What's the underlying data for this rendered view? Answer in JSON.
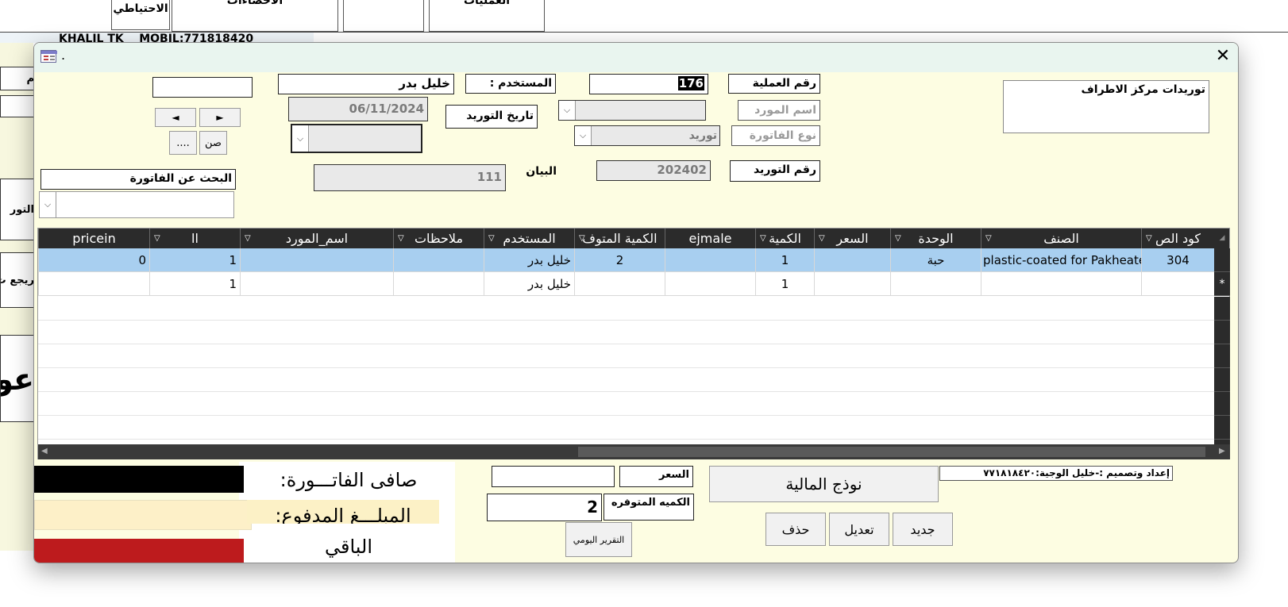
{
  "background": {
    "tabs": [
      {
        "label": "الاحتياطي"
      },
      {
        "label": "الاحصاءات"
      },
      {
        "label": ""
      },
      {
        "label": "العمليات"
      }
    ],
    "header_text": "KHALIL TK    MOBIL:771818420",
    "left_cut": [
      "م",
      "التور",
      "ريجع ت",
      "عو"
    ]
  },
  "dialog": {
    "title": ".",
    "panel_title": "توريدات مركز الاطراف",
    "op_number_label": "رقم العملية",
    "op_number_value": "176",
    "user_label": "المستخدم :",
    "user_value": "خليل بدر",
    "supplier_name_placeholder": "اسم المورد",
    "supply_date_label": "تاريخ التوريد",
    "supply_date_value": "06/11/2024",
    "invoice_type_placeholder": "نوع الفاتورة",
    "invoice_type_value": "توريد",
    "supply_number_label": "رقم التوريد",
    "supply_number_value": "202402",
    "statement_label": "البيان",
    "statement_value": "111",
    "search_invoice_label": "البحث عن الفاتورة",
    "btn_prev": "◄",
    "btn_next": "►",
    "btn_son": "صن",
    "btn_dots": "....",
    "grid": {
      "headers": [
        "كود الص",
        "الصنف",
        "الوحدة",
        "السعر",
        "الكمية",
        "ejmale",
        "الكمية المتوف",
        "المستخدم",
        "ملاحظات",
        "اسم_المورد",
        "ll",
        "pricein"
      ],
      "rows": [
        {
          "code": "304",
          "item": "plastic-coated for Pakheate",
          "unit": "حبة",
          "price": "",
          "qty": "1",
          "ejmale": "",
          "avail": "2",
          "user": "خليل بدر",
          "notes": "",
          "supplier": "",
          "ll": "1",
          "pricein": "0",
          "marker": ""
        },
        {
          "code": "",
          "item": "",
          "unit": "",
          "price": "",
          "qty": "1",
          "ejmale": "",
          "avail": "",
          "user": "خليل بدر",
          "notes": "",
          "supplier": "",
          "ll": "1",
          "pricein": "",
          "marker": "*"
        }
      ]
    },
    "credit": "إعداد وتصميم :-خليل الوجية:٧٧١٨١٨٤٢٠",
    "financial_form_button": "نوذج المالية",
    "btn_new": "جديد",
    "btn_edit": "تعديل",
    "btn_delete": "حذف",
    "price_label": "السعر",
    "available_qty_label": "الكميه المتوفره",
    "available_qty_value": "2",
    "daily_report_button": "التقرير اليومي",
    "net_invoice_label": "صافى الفاتـــورة:",
    "paid_label": "المبلـــغ المدفوع:",
    "remaining_label": "الباقي"
  }
}
